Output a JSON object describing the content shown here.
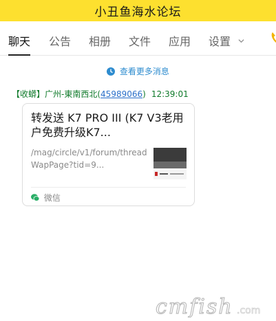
{
  "header": {
    "title": "小丑鱼海水论坛"
  },
  "tabs": [
    {
      "label": "聊天",
      "active": true
    },
    {
      "label": "公告"
    },
    {
      "label": "相册"
    },
    {
      "label": "文件"
    },
    {
      "label": "应用"
    },
    {
      "label": "设置"
    }
  ],
  "chat": {
    "more_messages": "查看更多消息",
    "sender": {
      "tag": "【收蟒】",
      "name": "广州-東南西北",
      "id_open": "(",
      "id": "45989066",
      "id_close": ")",
      "time": "12:39:01"
    },
    "card": {
      "title": "转发送 K7 PRO III (K7 V3老用户免费升级K7...",
      "url": "/mag/circle/v1/forum/threadWapPage?tid=9...",
      "source": "微信"
    }
  },
  "colors": {
    "header_bg": "#fde02f",
    "link_blue": "#2e8ccf",
    "sender_green": "#0f7a2a",
    "id_blue": "#2a6fc9"
  },
  "icons": [
    "clock-icon",
    "chevron-down-icon",
    "phone-icon",
    "wechat-icon"
  ]
}
